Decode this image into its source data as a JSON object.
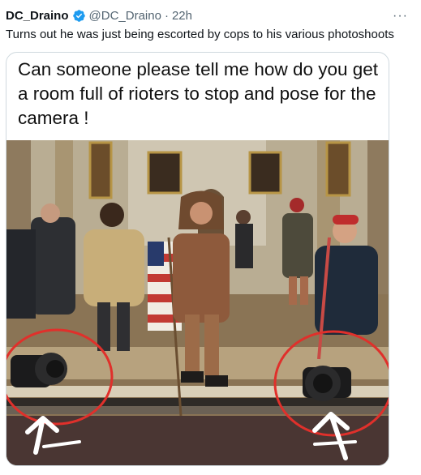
{
  "tweet": {
    "display_name": "DC_Draino",
    "handle": "@DC_Draino",
    "separator": "·",
    "time": "22h",
    "text": "Turns out he was just being escorted by cops to his various photoshoots",
    "more_icon": "more-horizontal-icon",
    "verified_icon": "verified-badge-icon"
  },
  "media": {
    "caption": "Can someone please tell me how do you get a room full of rioters to stop and pose for the camera !"
  },
  "colors": {
    "verified_blue": "#1d9bf0",
    "secondary_text": "#536471",
    "annotation_red": "#e0302b"
  }
}
